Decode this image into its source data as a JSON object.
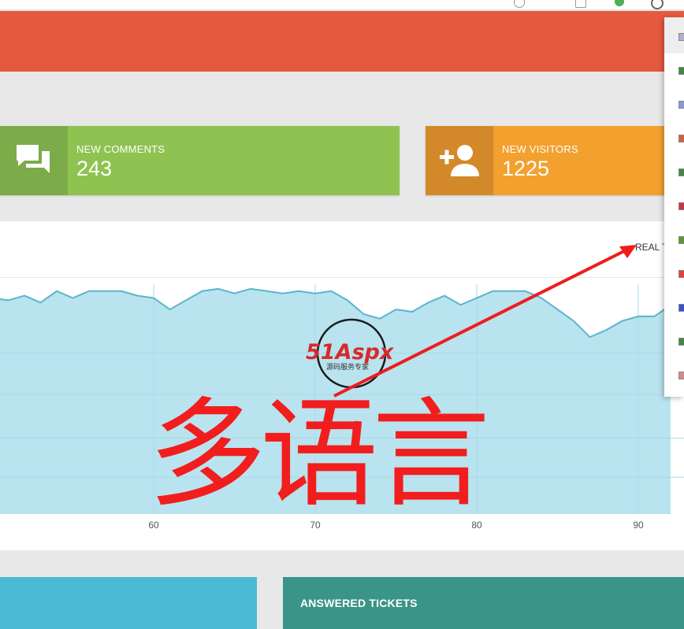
{
  "stats": [
    {
      "label": "NEW COMMENTS",
      "value": "243",
      "icon": "comments-icon",
      "icon_bg": "#7cab4a",
      "bg": "#8fc351"
    },
    {
      "label": "NEW VISITORS",
      "value": "1225",
      "icon": "add-user-icon",
      "icon_bg": "#d3892a",
      "bg": "#f2a12f"
    }
  ],
  "realtime": {
    "label": "REAL T"
  },
  "chart_data": {
    "type": "area",
    "x_ticks": [
      60,
      70,
      80,
      90
    ],
    "x": [
      50,
      51,
      52,
      53,
      54,
      55,
      56,
      57,
      58,
      59,
      60,
      61,
      62,
      63,
      64,
      65,
      66,
      67,
      68,
      69,
      70,
      71,
      72,
      73,
      74,
      75,
      76,
      77,
      78,
      79,
      80,
      81,
      82,
      83,
      84,
      85,
      86,
      87,
      88,
      89,
      90,
      91,
      92
    ],
    "values": [
      94,
      93,
      95,
      92,
      97,
      94,
      97,
      97,
      97,
      95,
      94,
      89,
      93,
      97,
      98,
      96,
      98,
      97,
      96,
      97,
      96,
      97,
      93,
      87,
      85,
      89,
      88,
      92,
      95,
      91,
      94,
      97,
      97,
      97,
      94,
      89,
      84,
      77,
      80,
      84,
      86,
      86,
      91
    ],
    "ylim": [
      0,
      100
    ],
    "fill_color": "#b9e3ef",
    "line_color": "#5ab4cf"
  },
  "overlay": {
    "text": "多语言",
    "watermark_brand": "51Aspx",
    "watermark_sub": "源码服务专家"
  },
  "bottom_cards": [
    {
      "title": "",
      "bg": "#4cb9d4"
    },
    {
      "title": "ANSWERED TICKETS",
      "bg": "#3a9487"
    }
  ],
  "languages": [
    "en",
    "lang-2",
    "lang-3",
    "de",
    "lang-5",
    "nl",
    "lang-7",
    "lang-8",
    "ru",
    "lang-10",
    "lang-11"
  ]
}
